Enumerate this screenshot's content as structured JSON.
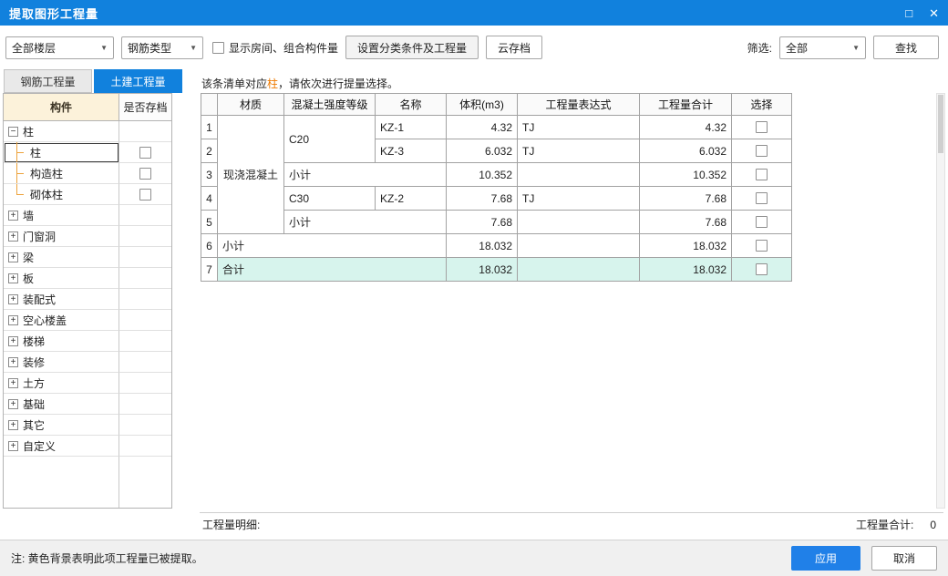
{
  "window": {
    "title": "提取图形工程量"
  },
  "icons": {
    "maximize": "□",
    "close": "✕",
    "dropdown": "▼",
    "plus": "+",
    "minus": "−"
  },
  "toolbar": {
    "floor_select": "全部楼层",
    "rebar_select": "钢筋类型",
    "show_room_checkbox": "显示房间、组合构件量",
    "set_category_button": "设置分类条件及工程量",
    "cloud_button": "云存档",
    "filter_label": "筛选:",
    "filter_select": "全部",
    "find_button": "查找"
  },
  "tabs": {
    "rebar": "钢筋工程量",
    "civil": "土建工程量"
  },
  "tree": {
    "col_component": "构件",
    "col_archived": "是否存档",
    "items": [
      {
        "label": "柱"
      },
      {
        "label": "柱"
      },
      {
        "label": "构造柱"
      },
      {
        "label": "砌体柱"
      },
      {
        "label": "墙"
      },
      {
        "label": "门窗洞"
      },
      {
        "label": "梁"
      },
      {
        "label": "板"
      },
      {
        "label": "装配式"
      },
      {
        "label": "空心楼盖"
      },
      {
        "label": "楼梯"
      },
      {
        "label": "装修"
      },
      {
        "label": "土方"
      },
      {
        "label": "基础"
      },
      {
        "label": "其它"
      },
      {
        "label": "自定义"
      }
    ]
  },
  "notice": {
    "prefix": "该条清单对应",
    "highlight": "柱",
    "suffix": "，请依次进行提量选择。"
  },
  "table": {
    "headers": {
      "material": "材质",
      "grade": "混凝土强度等级",
      "name": "名称",
      "volume": "体积(m3)",
      "expr": "工程量表达式",
      "total": "工程量合计",
      "select": "选择"
    },
    "rows": [
      {
        "num": "1",
        "material": "现浇混凝土",
        "grade": "C20",
        "name": "KZ-1",
        "volume": "4.32",
        "expr": "TJ",
        "total": "4.32"
      },
      {
        "num": "2",
        "name": "KZ-3",
        "volume": "6.032",
        "expr": "TJ",
        "total": "6.032"
      },
      {
        "num": "3",
        "label": "小计",
        "volume": "10.352",
        "expr": "",
        "total": "10.352"
      },
      {
        "num": "4",
        "grade": "C30",
        "name": "KZ-2",
        "volume": "7.68",
        "expr": "TJ",
        "total": "7.68"
      },
      {
        "num": "5",
        "label": "小计",
        "volume": "7.68",
        "expr": "",
        "total": "7.68"
      },
      {
        "num": "6",
        "label": "小计",
        "volume": "18.032",
        "expr": "",
        "total": "18.032"
      },
      {
        "num": "7",
        "label": "合计",
        "volume": "18.032",
        "expr": "",
        "total": "18.032"
      }
    ]
  },
  "status": {
    "detail_label": "工程量明细:",
    "total_label": "工程量合计:",
    "total_value": "0"
  },
  "footer": {
    "note": "注: 黄色背景表明此项工程量已被提取。",
    "apply_button": "应用",
    "cancel_button": "取消"
  }
}
